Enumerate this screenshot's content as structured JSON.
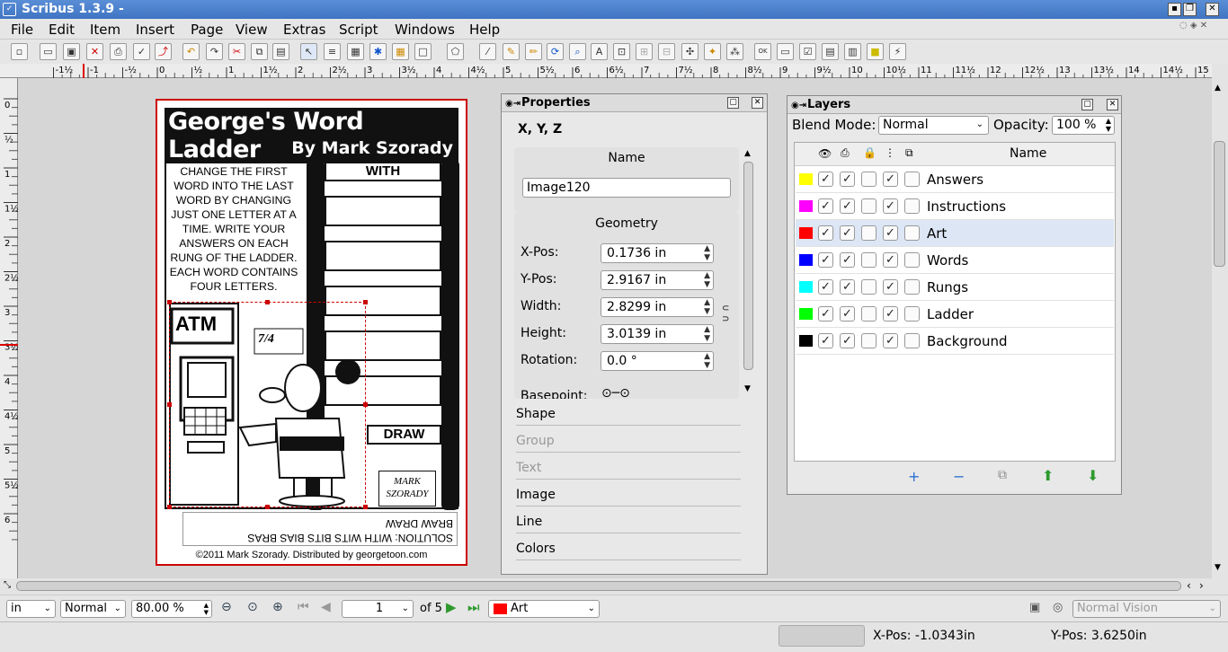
{
  "window": {
    "title": "Scribus 1.3.9 -"
  },
  "menu": [
    "File",
    "Edit",
    "Item",
    "Insert",
    "Page",
    "View",
    "Extras",
    "Script",
    "Windows",
    "Help"
  ],
  "ruler": {
    "h_ticks": [
      "-1½",
      "-1",
      "-½",
      "0",
      "½",
      "1",
      "1½",
      "2",
      "2½",
      "3",
      "3½",
      "4",
      "4½",
      "5",
      "5½",
      "6",
      "6½",
      "7",
      "7½",
      "8",
      "8½",
      "9",
      "9½",
      "10",
      "10½",
      "11",
      "11½",
      "12",
      "12½",
      "13",
      "13½",
      "14",
      "14½",
      "15"
    ],
    "v_ticks": [
      "0",
      "½",
      "1",
      "1½",
      "2",
      "2½",
      "3",
      "3½",
      "4",
      "4½",
      "5",
      "5½",
      "6"
    ]
  },
  "document": {
    "title": "George's Word Ladder",
    "byline": "By Mark Szorady",
    "instructions": "CHANGE THE FIRST WORD INTO THE LAST WORD BY CHANGING JUST ONE LETTER AT A TIME.  WRITE YOUR ANSWERS ON EACH RUNG OF THE LADDER. EACH WORD CONTAINS FOUR  LETTERS.",
    "first_word": "WITH",
    "last_word": "DRAW",
    "atm_sign": "ATM",
    "atm_hours": "7/4",
    "signature": "MARK SZORADY",
    "solution_line1": "BRAW DRAW",
    "solution_line2": "SOLUTION: WITH WITS BITS BIAS BRAS",
    "copyright": "©2011 Mark Szorady. Distributed by georgetoon.com"
  },
  "properties": {
    "title": "Properties",
    "tabs": "X, Y, Z",
    "name_label": "Name",
    "name_value": "Image120",
    "geometry_label": "Geometry",
    "fields": [
      {
        "label": "X-Pos:",
        "value": "0.1736 in"
      },
      {
        "label": "Y-Pos:",
        "value": "2.9167 in"
      },
      {
        "label": "Width:",
        "value": "2.8299 in"
      },
      {
        "label": "Height:",
        "value": "3.0139 in"
      },
      {
        "label": "Rotation:",
        "value": "0.0 °"
      }
    ],
    "basepoint_label": "Basepoint:",
    "sections": [
      "Shape",
      "Group",
      "Text",
      "Image",
      "Line",
      "Colors"
    ]
  },
  "layers": {
    "title": "Layers",
    "blend_label": "Blend Mode:",
    "blend_value": "Normal",
    "opacity_label": "Opacity:",
    "opacity_value": "100 %",
    "name_header": "Name",
    "rows": [
      {
        "name": "Answers",
        "color": "#ffff00"
      },
      {
        "name": "Instructions",
        "color": "#ff00ff"
      },
      {
        "name": "Art",
        "color": "#ff0000"
      },
      {
        "name": "Words",
        "color": "#0000ff"
      },
      {
        "name": "Rungs",
        "color": "#00ffff"
      },
      {
        "name": "Ladder",
        "color": "#00ff00"
      },
      {
        "name": "Background",
        "color": "#000000"
      }
    ],
    "selected": "Art"
  },
  "bottom": {
    "unit": "in",
    "mode": "Normal",
    "zoom": "80.00 %",
    "page": "1",
    "of_pages": "of 5",
    "layer": "Art",
    "layer_color": "#ff0000",
    "vision": "Normal Vision"
  },
  "status": {
    "xpos": "X-Pos: -1.0343in",
    "ypos": "Y-Pos: 3.6250in"
  }
}
